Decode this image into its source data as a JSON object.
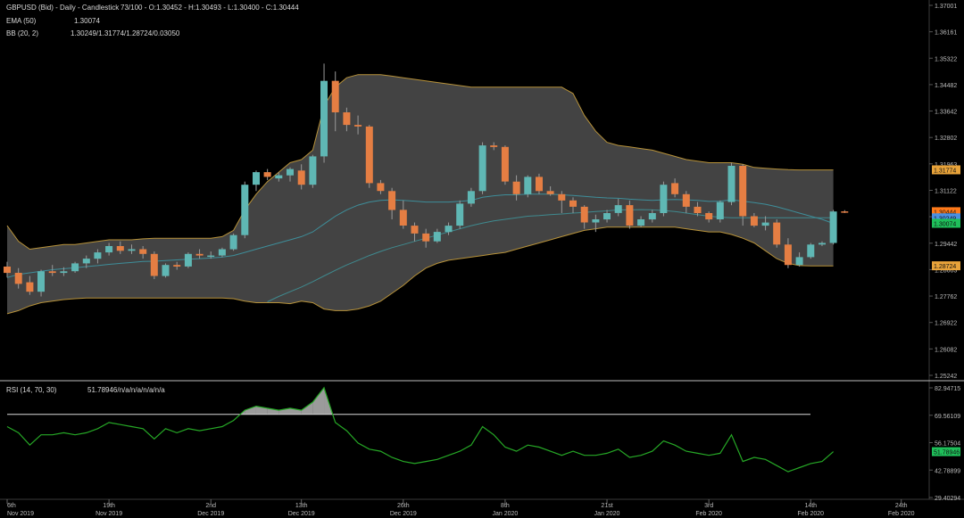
{
  "legend": {
    "title": "GBPUSD (Bid) - Daily - Candlestick",
    "ohlc": "73/100 - O:1.30452 - H:1.30493 - L:1.30400 - C:1.30444",
    "ema_label": "EMA (50)",
    "ema_value": "1.30074",
    "bb_label": "BB (20, 2)",
    "bb_value": "1.30249/1.31774/1.28724/0.03050",
    "rsi_label": "RSI (14, 70, 30)",
    "rsi_value": "51.78946/n/a/n/a/n/a/n/a"
  },
  "price_axis": {
    "ticks": [
      "1.37001",
      "1.36161",
      "1.35322",
      "1.34482",
      "1.33642",
      "1.32802",
      "1.31963",
      "1.31122",
      "1.30283",
      "1.29442",
      "1.28603",
      "1.27762",
      "1.26922",
      "1.26082",
      "1.25242"
    ],
    "tick_values": [
      1.37001,
      1.36161,
      1.35322,
      1.34482,
      1.33642,
      1.32802,
      1.31963,
      1.31122,
      1.30283,
      1.29442,
      1.28603,
      1.27762,
      1.26922,
      1.26082,
      1.25242
    ],
    "range": [
      1.25242,
      1.37001
    ]
  },
  "price_badges": [
    {
      "label": "1.31774",
      "value": 1.31774,
      "color": "#e8a33a"
    },
    {
      "label": "1.30444",
      "value": 1.30444,
      "color": "#ff7a1a"
    },
    {
      "label": "1.30249",
      "value": 1.30249,
      "color": "#4a90e2"
    },
    {
      "label": "1.30074",
      "value": 1.30074,
      "color": "#1ec05a"
    },
    {
      "label": "1.28724",
      "value": 1.28724,
      "color": "#e8a33a"
    }
  ],
  "rsi_axis": {
    "ticks": [
      "82.94715",
      "69.56109",
      "56.17504",
      "42.78899",
      "29.40294"
    ],
    "tick_values": [
      82.94715,
      69.56109,
      56.17504,
      42.78899,
      29.40294
    ],
    "range": [
      29.40294,
      82.94715
    ],
    "badge": {
      "label": "51.78946",
      "value": 51.78946,
      "color": "#1ec05a"
    }
  },
  "time_axis": [
    {
      "day": "6th",
      "month": "Nov 2019",
      "bar": 0
    },
    {
      "day": "19th",
      "month": "Nov 2019",
      "bar": 9
    },
    {
      "day": "2nd",
      "month": "Dec 2019",
      "bar": 18
    },
    {
      "day": "13th",
      "month": "Dec 2019",
      "bar": 26
    },
    {
      "day": "26th",
      "month": "Dec 2019",
      "bar": 35
    },
    {
      "day": "8th",
      "month": "Jan 2020",
      "bar": 44
    },
    {
      "day": "21st",
      "month": "Jan 2020",
      "bar": 53
    },
    {
      "day": "3rd",
      "month": "Feb 2020",
      "bar": 62
    },
    {
      "day": "14th",
      "month": "Feb 2020",
      "bar": 71
    },
    {
      "day": "24th",
      "month": "Feb 2020",
      "bar": 79
    }
  ],
  "colors": {
    "up": "#5fb7b4",
    "down": "#e57e43",
    "band_fill": "#4f4f4f",
    "band_line": "#b7923a",
    "ema": "#3e8e9a",
    "rsi": "#26a826",
    "rsi_over": "#cfcfcf"
  },
  "chart_data": {
    "type": "candlestick",
    "ohlc": [
      [
        1.287,
        1.2885,
        1.2835,
        1.285
      ],
      [
        1.285,
        1.2865,
        1.28,
        1.2815
      ],
      [
        1.282,
        1.284,
        1.278,
        1.279
      ],
      [
        1.279,
        1.286,
        1.2775,
        1.2855
      ],
      [
        1.2855,
        1.2875,
        1.284,
        1.285
      ],
      [
        1.285,
        1.2868,
        1.284,
        1.2855
      ],
      [
        1.2855,
        1.2885,
        1.285,
        1.288
      ],
      [
        1.288,
        1.2905,
        1.2865,
        1.2895
      ],
      [
        1.2895,
        1.2925,
        1.288,
        1.2915
      ],
      [
        1.2915,
        1.2945,
        1.2905,
        1.2935
      ],
      [
        1.2935,
        1.295,
        1.291,
        1.292
      ],
      [
        1.292,
        1.294,
        1.291,
        1.2925
      ],
      [
        1.2925,
        1.2935,
        1.2895,
        1.291
      ],
      [
        1.291,
        1.2918,
        1.283,
        1.284
      ],
      [
        1.284,
        1.288,
        1.2835,
        1.2875
      ],
      [
        1.2875,
        1.2885,
        1.286,
        1.287
      ],
      [
        1.287,
        1.2915,
        1.2865,
        1.291
      ],
      [
        1.291,
        1.2925,
        1.2895,
        1.2905
      ],
      [
        1.2905,
        1.2918,
        1.2895,
        1.2905
      ],
      [
        1.2905,
        1.293,
        1.29,
        1.2925
      ],
      [
        1.2925,
        1.2975,
        1.292,
        1.297
      ],
      [
        1.297,
        1.314,
        1.296,
        1.313
      ],
      [
        1.313,
        1.3175,
        1.311,
        1.317
      ],
      [
        1.317,
        1.318,
        1.3145,
        1.3155
      ],
      [
        1.315,
        1.317,
        1.314,
        1.316
      ],
      [
        1.316,
        1.3185,
        1.314,
        1.318
      ],
      [
        1.3175,
        1.3195,
        1.3115,
        1.313
      ],
      [
        1.313,
        1.3225,
        1.312,
        1.322
      ],
      [
        1.322,
        1.3515,
        1.32,
        1.346
      ],
      [
        1.346,
        1.349,
        1.33,
        1.336
      ],
      [
        1.336,
        1.3375,
        1.33,
        1.332
      ],
      [
        1.332,
        1.335,
        1.329,
        1.3315
      ],
      [
        1.3315,
        1.332,
        1.312,
        1.3135
      ],
      [
        1.3135,
        1.3145,
        1.31,
        1.311
      ],
      [
        1.311,
        1.312,
        1.302,
        1.305
      ],
      [
        1.305,
        1.308,
        1.299,
        1.3
      ],
      [
        1.3,
        1.301,
        1.295,
        1.2975
      ],
      [
        1.2975,
        1.299,
        1.293,
        1.295
      ],
      [
        1.295,
        1.299,
        1.2945,
        1.298
      ],
      [
        1.298,
        1.301,
        1.297,
        1.3
      ],
      [
        1.3,
        1.308,
        1.299,
        1.307
      ],
      [
        1.307,
        1.312,
        1.306,
        1.311
      ],
      [
        1.311,
        1.3265,
        1.31,
        1.3255
      ],
      [
        1.3255,
        1.3265,
        1.324,
        1.325
      ],
      [
        1.325,
        1.3255,
        1.313,
        1.314
      ],
      [
        1.314,
        1.316,
        1.308,
        1.31
      ],
      [
        1.31,
        1.316,
        1.309,
        1.3155
      ],
      [
        1.3155,
        1.3165,
        1.31,
        1.311
      ],
      [
        1.311,
        1.3125,
        1.3095,
        1.31
      ],
      [
        1.31,
        1.311,
        1.304,
        1.308
      ],
      [
        1.308,
        1.309,
        1.304,
        1.306
      ],
      [
        1.306,
        1.3065,
        1.299,
        1.301
      ],
      [
        1.301,
        1.3035,
        1.298,
        1.302
      ],
      [
        1.302,
        1.305,
        1.301,
        1.304
      ],
      [
        1.304,
        1.3085,
        1.303,
        1.3065
      ],
      [
        1.3065,
        1.308,
        1.299,
        1.3
      ],
      [
        1.3,
        1.303,
        1.2995,
        1.302
      ],
      [
        1.302,
        1.305,
        1.301,
        1.304
      ],
      [
        1.304,
        1.314,
        1.303,
        1.313
      ],
      [
        1.3135,
        1.315,
        1.309,
        1.31
      ],
      [
        1.31,
        1.311,
        1.304,
        1.306
      ],
      [
        1.306,
        1.3075,
        1.303,
        1.304
      ],
      [
        1.304,
        1.3045,
        1.301,
        1.302
      ],
      [
        1.302,
        1.308,
        1.301,
        1.3075
      ],
      [
        1.3075,
        1.32,
        1.3065,
        1.319
      ],
      [
        1.319,
        1.3195,
        1.3,
        1.303
      ],
      [
        1.303,
        1.304,
        1.2995,
        1.3
      ],
      [
        1.3,
        1.303,
        1.2985,
        1.301
      ],
      [
        1.301,
        1.302,
        1.293,
        1.294
      ],
      [
        1.294,
        1.296,
        1.2865,
        1.2875
      ],
      [
        1.2875,
        1.2915,
        1.287,
        1.29
      ],
      [
        1.29,
        1.2945,
        1.2895,
        1.294
      ],
      [
        1.294,
        1.295,
        1.2935,
        1.2945
      ],
      [
        1.2945,
        1.305,
        1.294,
        1.3045
      ],
      [
        1.30452,
        1.30493,
        1.304,
        1.30444
      ]
    ],
    "bb_upper": [
      1.3,
      1.295,
      1.2925,
      1.293,
      1.2935,
      1.294,
      1.294,
      1.2945,
      1.295,
      1.2955,
      1.2955,
      1.2955,
      1.2958,
      1.296,
      1.296,
      1.296,
      1.296,
      1.296,
      1.296,
      1.2965,
      1.2985,
      1.305,
      1.31,
      1.314,
      1.317,
      1.32,
      1.321,
      1.324,
      1.338,
      1.344,
      1.347,
      1.348,
      1.348,
      1.348,
      1.3475,
      1.347,
      1.3465,
      1.346,
      1.3455,
      1.345,
      1.3445,
      1.344,
      1.344,
      1.344,
      1.344,
      1.344,
      1.344,
      1.344,
      1.344,
      1.344,
      1.342,
      1.335,
      1.33,
      1.3265,
      1.3255,
      1.325,
      1.3245,
      1.324,
      1.323,
      1.322,
      1.321,
      1.3205,
      1.32,
      1.32,
      1.32,
      1.3195,
      1.3185,
      1.3182,
      1.318,
      1.3178,
      1.3177,
      1.3177,
      1.3177,
      1.3177
    ],
    "bb_lower": [
      1.272,
      1.273,
      1.2745,
      1.2755,
      1.276,
      1.2765,
      1.2768,
      1.277,
      1.277,
      1.277,
      1.277,
      1.277,
      1.277,
      1.277,
      1.277,
      1.277,
      1.277,
      1.277,
      1.277,
      1.277,
      1.2768,
      1.276,
      1.2755,
      1.2755,
      1.2755,
      1.2752,
      1.276,
      1.2755,
      1.2735,
      1.273,
      1.273,
      1.2735,
      1.2745,
      1.276,
      1.2785,
      1.281,
      1.284,
      1.2865,
      1.288,
      1.289,
      1.2895,
      1.29,
      1.2905,
      1.291,
      1.2915,
      1.2925,
      1.2935,
      1.2945,
      1.2955,
      1.2965,
      1.2975,
      1.2985,
      1.299,
      1.2995,
      1.2995,
      1.2995,
      1.2995,
      1.2995,
      1.2995,
      1.2995,
      1.299,
      1.2985,
      1.298,
      1.298,
      1.2972,
      1.296,
      1.2945,
      1.292,
      1.2895,
      1.288,
      1.2873,
      1.2872,
      1.2872,
      1.2872
    ],
    "bb_middle_start": 23,
    "bb_middle": [
      1.2758,
      1.2775,
      1.279,
      1.2805,
      1.2822,
      1.284,
      1.2858,
      1.2875,
      1.289,
      1.2905,
      1.2918,
      1.293,
      1.294,
      1.295,
      1.296,
      1.297,
      1.298,
      1.299,
      1.3,
      1.3008,
      1.3015,
      1.302,
      1.3025,
      1.303,
      1.3032,
      1.3035,
      1.3037,
      1.304,
      1.3042,
      1.3045,
      1.3047,
      1.305,
      1.305,
      1.3051,
      1.305,
      1.3048,
      1.3045,
      1.304,
      1.3035,
      1.303,
      1.3027,
      1.3025,
      1.3025,
      1.3025,
      1.3025,
      1.3025,
      1.3025,
      1.3025,
      1.3025,
      1.3025,
      1.3025
    ],
    "ema": [
      1.2835,
      1.2845,
      1.285,
      1.2855,
      1.286,
      1.2863,
      1.2866,
      1.287,
      1.2873,
      1.2877,
      1.288,
      1.2883,
      1.2886,
      1.2887,
      1.2889,
      1.2891,
      1.2893,
      1.2895,
      1.2897,
      1.29,
      1.2905,
      1.2915,
      1.2925,
      1.2935,
      1.2945,
      1.2955,
      1.2965,
      1.298,
      1.3005,
      1.303,
      1.305,
      1.3065,
      1.3075,
      1.308,
      1.3082,
      1.308,
      1.3078,
      1.3075,
      1.3075,
      1.3075,
      1.3077,
      1.308,
      1.309,
      1.3095,
      1.3098,
      1.3098,
      1.31,
      1.31,
      1.31,
      1.3098,
      1.3096,
      1.3093,
      1.309,
      1.3088,
      1.3087,
      1.3084,
      1.3082,
      1.308,
      1.3082,
      1.3083,
      1.3082,
      1.308,
      1.3077,
      1.3078,
      1.3082,
      1.3078,
      1.3073,
      1.3068,
      1.306,
      1.305,
      1.304,
      1.303,
      1.302,
      1.3007
    ],
    "rsi": [
      64,
      61,
      55,
      60,
      60,
      61,
      60,
      61,
      63,
      66,
      65,
      64,
      63,
      58,
      63,
      61,
      63,
      62,
      63,
      64,
      67,
      72,
      74,
      73,
      72,
      73,
      72,
      76,
      83,
      66,
      62,
      56,
      53,
      52,
      49,
      47,
      46,
      47,
      48,
      50,
      52,
      55,
      64,
      60,
      54,
      52,
      55,
      54,
      52,
      50,
      52,
      50,
      50,
      51,
      53,
      49,
      50,
      52,
      57,
      55,
      52,
      51,
      50,
      51,
      60,
      47,
      49,
      48,
      45,
      42,
      44,
      46,
      47,
      51.78946
    ]
  }
}
